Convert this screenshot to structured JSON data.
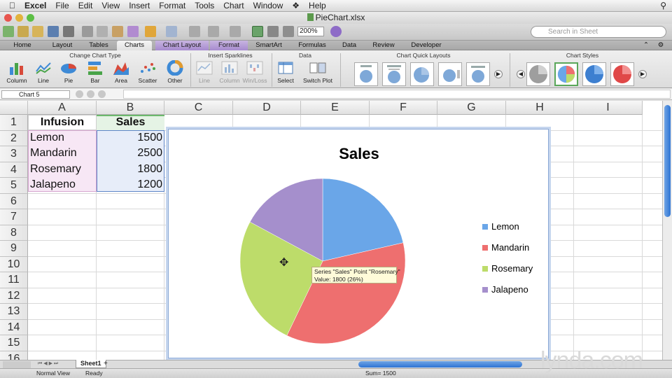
{
  "menubar": {
    "apple": "",
    "app": "Excel",
    "items": [
      "File",
      "Edit",
      "View",
      "Insert",
      "Format",
      "Tools",
      "Chart",
      "Window",
      "Help"
    ]
  },
  "window": {
    "title": "PieChart.xlsx"
  },
  "toolbar": {
    "zoom": "200%",
    "search_placeholder": "Search in Sheet"
  },
  "ribbon_tabs": [
    "Home",
    "Layout",
    "Tables",
    "Charts",
    "Chart Layout",
    "Format",
    "SmartArt",
    "Formulas",
    "Data",
    "Review",
    "Developer"
  ],
  "ribbon_groups": {
    "change_chart_type": {
      "label": "Change Chart Type",
      "buttons": [
        "Column",
        "Line",
        "Pie",
        "Bar",
        "Area",
        "Scatter",
        "Other"
      ]
    },
    "insert_sparklines": {
      "label": "Insert Sparklines",
      "buttons": [
        "Line",
        "Column",
        "Win/Loss"
      ]
    },
    "data": {
      "label": "Data",
      "buttons": [
        "Select",
        "Switch Plot"
      ]
    },
    "quick_layouts": {
      "label": "Chart Quick Layouts"
    },
    "chart_styles": {
      "label": "Chart Styles"
    }
  },
  "formula_bar": {
    "name_box": "Chart 5"
  },
  "columns": [
    "A",
    "B",
    "C",
    "D",
    "E",
    "F",
    "G",
    "H",
    "I"
  ],
  "rows": [
    "1",
    "2",
    "3",
    "4",
    "5",
    "6",
    "7",
    "8",
    "9",
    "10",
    "11",
    "12",
    "13",
    "14",
    "15",
    "16"
  ],
  "table": {
    "headers": [
      "Infusion",
      "Sales"
    ],
    "rows": [
      [
        "Lemon",
        "1500"
      ],
      [
        "Mandarin",
        "2500"
      ],
      [
        "Rosemary",
        "1800"
      ],
      [
        "Jalapeno",
        "1200"
      ]
    ]
  },
  "tooltip": {
    "line1": "Series \"Sales\" Point \"Rosemary\"",
    "line2": "Value: 1800 (26%)"
  },
  "chart_data": {
    "type": "pie",
    "title": "Sales",
    "categories": [
      "Lemon",
      "Mandarin",
      "Rosemary",
      "Jalapeno"
    ],
    "values": [
      1500,
      2500,
      1800,
      1200
    ],
    "colors": [
      "#6aa6e8",
      "#ee6f6f",
      "#bddc6a",
      "#a58fcc"
    ],
    "legend": "right"
  },
  "sheet_tabs": [
    "Sheet1"
  ],
  "status": {
    "view": "Normal View",
    "state": "Ready",
    "sum": "Sum= 1500"
  },
  "watermark": "lynda.com"
}
